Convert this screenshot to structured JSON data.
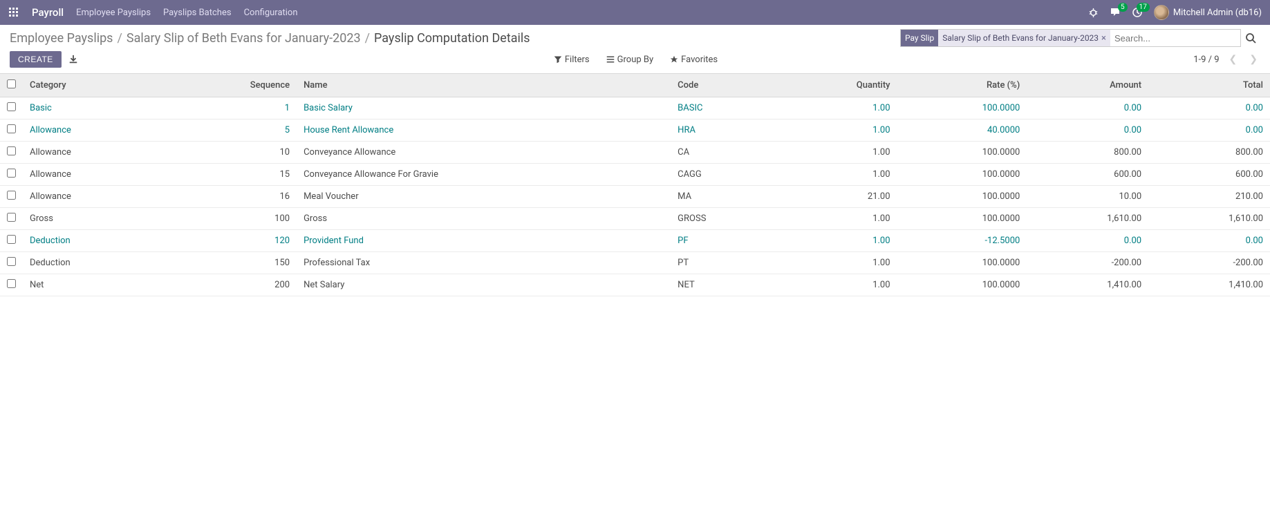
{
  "nav": {
    "brand": "Payroll",
    "links": [
      "Employee Payslips",
      "Payslips Batches",
      "Configuration"
    ],
    "msg_count": "5",
    "activity_count": "17",
    "user": "Mitchell Admin (db16)"
  },
  "breadcrumb": {
    "items": [
      "Employee Payslips",
      "Salary Slip of Beth Evans for January-2023",
      "Payslip Computation Details"
    ]
  },
  "search": {
    "facet_label": "Pay Slip",
    "facet_value": "Salary Slip of Beth Evans for January-2023",
    "placeholder": "Search..."
  },
  "buttons": {
    "create": "CREATE"
  },
  "tools": {
    "filters": "Filters",
    "groupby": "Group By",
    "favorites": "Favorites"
  },
  "pager": "1-9 / 9",
  "columns": {
    "category": "Category",
    "sequence": "Sequence",
    "name": "Name",
    "code": "Code",
    "quantity": "Quantity",
    "rate": "Rate (%)",
    "amount": "Amount",
    "total": "Total"
  },
  "rows": [
    {
      "category": "Basic",
      "sequence": "1",
      "name": "Basic Salary",
      "code": "BASIC",
      "quantity": "1.00",
      "rate": "100.0000",
      "amount": "0.00",
      "total": "0.00",
      "linked": true
    },
    {
      "category": "Allowance",
      "sequence": "5",
      "name": "House Rent Allowance",
      "code": "HRA",
      "quantity": "1.00",
      "rate": "40.0000",
      "amount": "0.00",
      "total": "0.00",
      "linked": true
    },
    {
      "category": "Allowance",
      "sequence": "10",
      "name": "Conveyance Allowance",
      "code": "CA",
      "quantity": "1.00",
      "rate": "100.0000",
      "amount": "800.00",
      "total": "800.00",
      "linked": false
    },
    {
      "category": "Allowance",
      "sequence": "15",
      "name": "Conveyance Allowance For Gravie",
      "code": "CAGG",
      "quantity": "1.00",
      "rate": "100.0000",
      "amount": "600.00",
      "total": "600.00",
      "linked": false
    },
    {
      "category": "Allowance",
      "sequence": "16",
      "name": "Meal Voucher",
      "code": "MA",
      "quantity": "21.00",
      "rate": "100.0000",
      "amount": "10.00",
      "total": "210.00",
      "linked": false
    },
    {
      "category": "Gross",
      "sequence": "100",
      "name": "Gross",
      "code": "GROSS",
      "quantity": "1.00",
      "rate": "100.0000",
      "amount": "1,610.00",
      "total": "1,610.00",
      "linked": false
    },
    {
      "category": "Deduction",
      "sequence": "120",
      "name": "Provident Fund",
      "code": "PF",
      "quantity": "1.00",
      "rate": "-12.5000",
      "amount": "0.00",
      "total": "0.00",
      "linked": true
    },
    {
      "category": "Deduction",
      "sequence": "150",
      "name": "Professional Tax",
      "code": "PT",
      "quantity": "1.00",
      "rate": "100.0000",
      "amount": "-200.00",
      "total": "-200.00",
      "linked": false
    },
    {
      "category": "Net",
      "sequence": "200",
      "name": "Net Salary",
      "code": "NET",
      "quantity": "1.00",
      "rate": "100.0000",
      "amount": "1,410.00",
      "total": "1,410.00",
      "linked": false
    }
  ]
}
